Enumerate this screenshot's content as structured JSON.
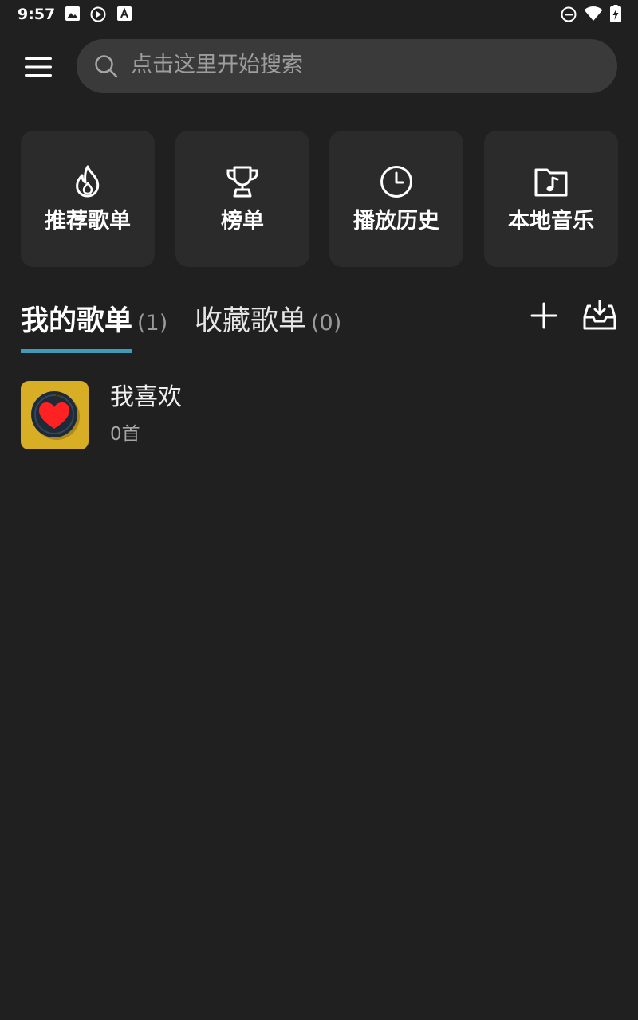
{
  "status_bar": {
    "time": "9:57",
    "left_icons": [
      "image-icon",
      "play-circle-icon",
      "text-a-icon"
    ],
    "right_icons": [
      "do-not-disturb-icon",
      "wifi-icon",
      "battery-charging-icon"
    ]
  },
  "search": {
    "placeholder": "点击这里开始搜索"
  },
  "shortcuts": [
    {
      "label": "推荐歌单",
      "icon": "fire-icon"
    },
    {
      "label": "榜单",
      "icon": "trophy-icon"
    },
    {
      "label": "播放历史",
      "icon": "clock-icon"
    },
    {
      "label": "本地音乐",
      "icon": "music-folder-icon"
    }
  ],
  "tabs": [
    {
      "title": "我的歌单",
      "count": "(1)",
      "active": true
    },
    {
      "title": "收藏歌单",
      "count": "(0)",
      "active": false
    }
  ],
  "actions": {
    "add_icon": "plus-icon",
    "import_icon": "inbox-download-icon"
  },
  "playlists": [
    {
      "name": "我喜欢",
      "count": "0首"
    }
  ],
  "colors": {
    "background": "#202020",
    "tile": "#2b2b2b",
    "search_bg": "#3a3a3a",
    "accent": "#3f9bb6",
    "cover_bg": "#d8ae24",
    "heart": "#ff2222"
  }
}
